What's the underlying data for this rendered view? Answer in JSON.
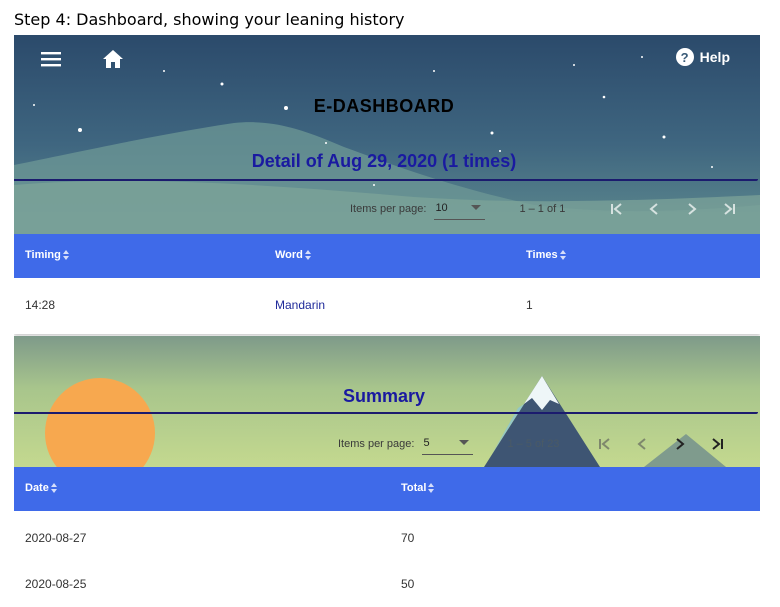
{
  "caption": "Step 4: Dashboard, showing your leaning history",
  "header": {
    "menu_icon": "menu-icon",
    "home_icon": "home-icon",
    "help_label": "Help",
    "help_symbol": "?",
    "app_title": "E-DASHBOARD"
  },
  "detail": {
    "title": "Detail of Aug 29, 2020 (1 times)",
    "paginator": {
      "items_per_page_label": "Items per page:",
      "page_size": "10",
      "range": "1 – 1 of 1"
    },
    "columns": [
      "Timing",
      "Word",
      "Times"
    ],
    "rows": [
      {
        "timing": "14:28",
        "word": "Mandarin",
        "times": "1"
      }
    ]
  },
  "summary": {
    "title": "Summary",
    "paginator": {
      "items_per_page_label": "Items per page:",
      "page_size": "5",
      "range": "1 – 5 of 23"
    },
    "columns": [
      "Date",
      "Total"
    ],
    "rows": [
      {
        "date": "2020-08-27",
        "total": "70"
      },
      {
        "date": "2020-08-25",
        "total": "50"
      }
    ]
  },
  "colors": {
    "table_header": "#3f6ae9",
    "title_text": "#1a1aa0",
    "link_text": "#1f2a9a"
  }
}
